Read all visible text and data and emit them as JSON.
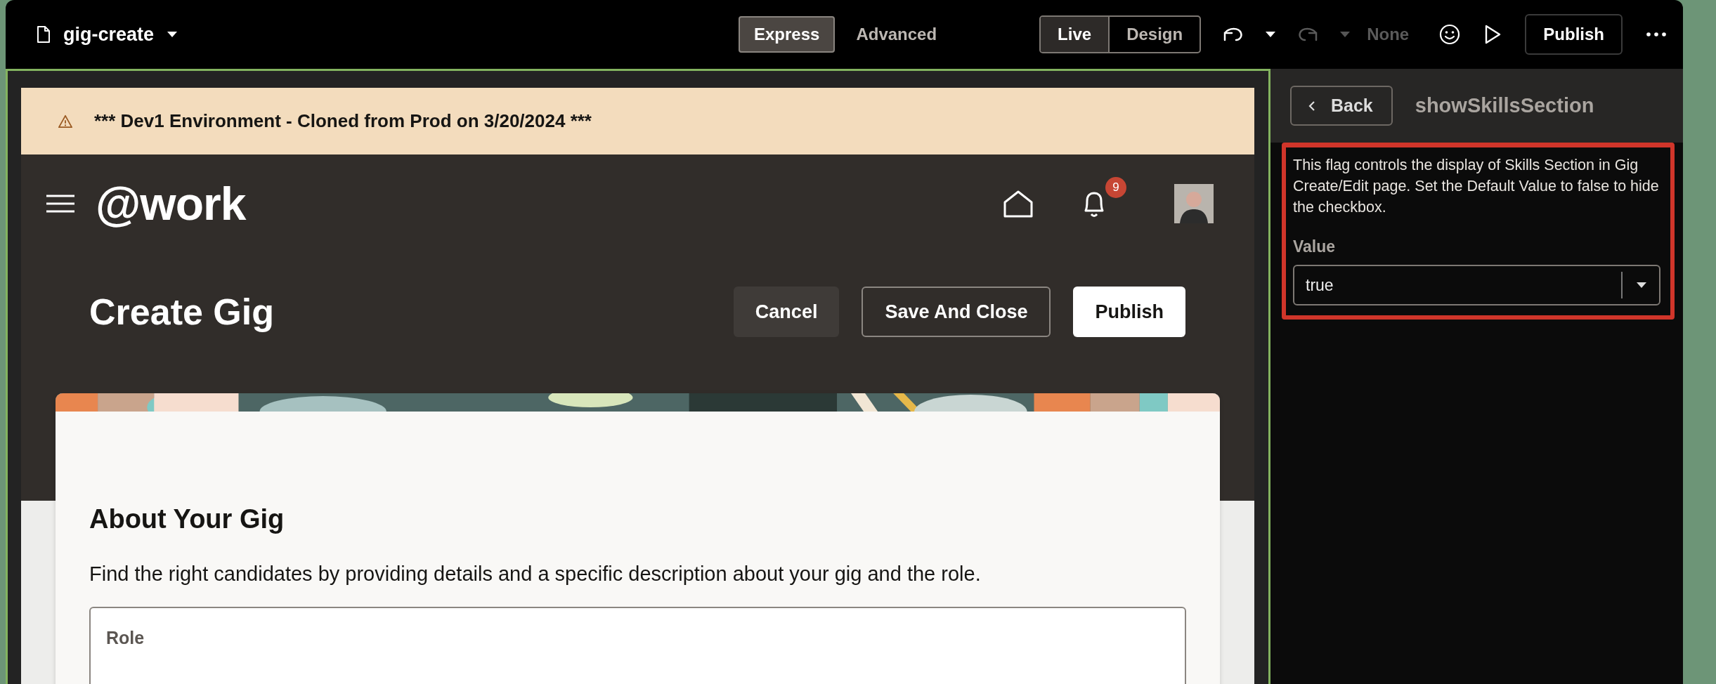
{
  "toolbar": {
    "page_name": "gig-create",
    "mode_tabs": [
      {
        "label": "Express",
        "selected": true
      },
      {
        "label": "Advanced",
        "selected": false
      }
    ],
    "view_tabs": [
      {
        "label": "Live",
        "selected": true
      },
      {
        "label": "Design",
        "selected": false
      }
    ],
    "undo": {
      "disabled": false
    },
    "redo": {
      "disabled": true
    },
    "history_label": "None",
    "publish_label": "Publish"
  },
  "preview": {
    "banner": "*** Dev1 Environment - Cloned from Prod on 3/20/2024 ***",
    "app_name": "@work",
    "notification_count": "9",
    "page_title": "Create Gig",
    "actions": [
      {
        "label": "Cancel",
        "kind": "secondary"
      },
      {
        "label": "Save And Close",
        "kind": "outline"
      },
      {
        "label": "Publish",
        "kind": "primary"
      }
    ],
    "card": {
      "heading": "About Your Gig",
      "description": "Find the right candidates by providing details and a specific description about your gig and the role.",
      "field_label": "Role"
    }
  },
  "panel": {
    "back_label": "Back",
    "title": "showSkillsSection",
    "description": "This flag controls the display of Skills Section in Gig Create/Edit page. Set the Default Value to false to hide the checkbox.",
    "value_label": "Value",
    "value": "true",
    "highlighted": true
  }
}
